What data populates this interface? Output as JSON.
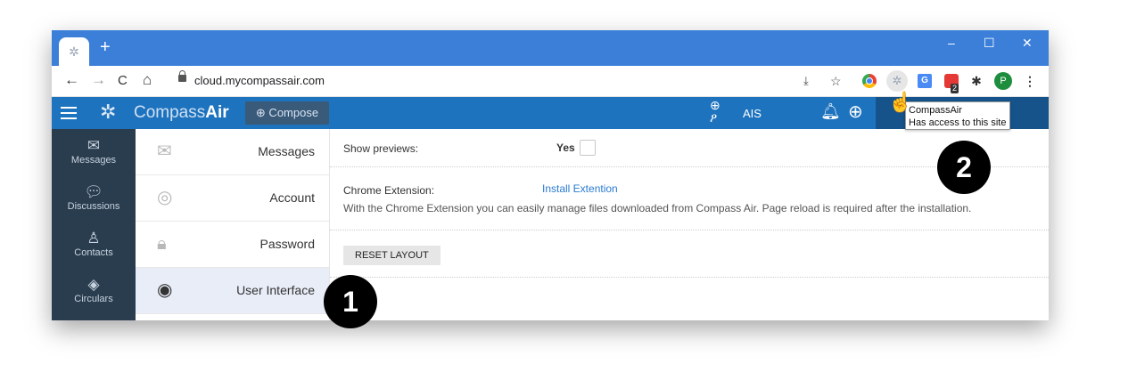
{
  "browser": {
    "tab_icon": "✲",
    "new_tab": "+",
    "window_controls": {
      "minimize": "–",
      "maximize": "☐",
      "close": "✕"
    },
    "nav": {
      "back": "←",
      "forward": "→",
      "reload": "C",
      "home": "⌂"
    },
    "url": "cloud.mycompassair.com",
    "extensions": {
      "translate_label": "G",
      "badge": "2",
      "profile_initial": "P",
      "menu": "⋮",
      "puzzle": "✱"
    }
  },
  "app": {
    "brand_light": "Compass",
    "brand_bold": "Air",
    "compose_label": "⊕ Compose",
    "ais_label": "AIS",
    "user_chevron": "⌄"
  },
  "tooltip": {
    "title": "CompassAir",
    "subtitle": "Has access to this site"
  },
  "left_nav": [
    {
      "label": "Messages",
      "icon": "envelope-icon"
    },
    {
      "label": "Discussions",
      "icon": "chat-icon"
    },
    {
      "label": "Contacts",
      "icon": "person-icon"
    },
    {
      "label": "Circulars",
      "icon": "compass-icon"
    }
  ],
  "settings_menu": [
    {
      "label": "Messages",
      "icon": "envelope-icon"
    },
    {
      "label": "Account",
      "icon": "user-circle-icon"
    },
    {
      "label": "Password",
      "icon": "lock-icon"
    },
    {
      "label": "User Interface",
      "icon": "eye-icon",
      "active": true
    }
  ],
  "content": {
    "show_previews_label": "Show previews:",
    "show_previews_value": "Yes",
    "chrome_ext_label": "Chrome Extension:",
    "install_link": "Install Extention",
    "description": "With the Chrome Extension you can easily manage files downloaded from Compass Air. Page reload is required after the installation.",
    "reset_label": "RESET LAYOUT"
  },
  "annotations": {
    "one": "1",
    "two": "2"
  },
  "colors": {
    "chrome_blue": "#3c7fd9",
    "app_header": "#1e73be",
    "left_nav": "#2a3d4f",
    "active_item": "#e9edf8",
    "link": "#2a7bd1"
  }
}
